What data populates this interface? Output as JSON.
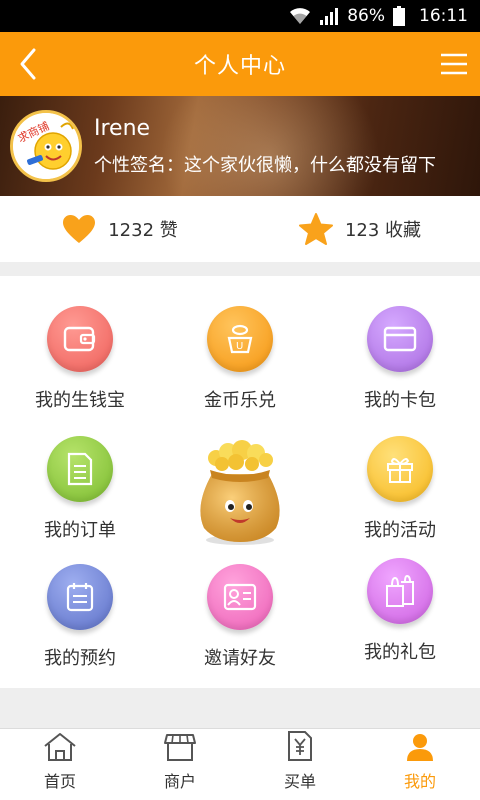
{
  "status_bar": {
    "battery": "86%",
    "time": "16:11"
  },
  "header": {
    "title": "个人中心"
  },
  "profile": {
    "name": "Irene",
    "signature": "个性签名：这个家伙很懒，什么都没有留下",
    "avatar_text": "求商铺"
  },
  "stats": {
    "likes": "1232",
    "likes_label": "赞",
    "favorites": "123",
    "favorites_label": "收藏"
  },
  "grid": [
    {
      "label": "我的生钱宝",
      "icon": "wallet-icon",
      "color": "#f0706b"
    },
    {
      "label": "金币乐兑",
      "icon": "coin-cup-icon",
      "color": "#f7a01e"
    },
    {
      "label": "我的卡包",
      "icon": "card-icon",
      "color": "#b57de6"
    },
    {
      "label": "我的订单",
      "icon": "order-icon",
      "color": "#8cc63e"
    },
    {
      "label": "我的活动",
      "icon": "gift-box-icon",
      "color": "#f9c534"
    },
    {
      "label": "我的预约",
      "icon": "calendar-icon",
      "color": "#6f83d4"
    },
    {
      "label": "邀请好友",
      "icon": "contact-card-icon",
      "color": "#f06bbf"
    },
    {
      "label": "我的礼包",
      "icon": "gift-bag-icon",
      "color": "#d86be8"
    }
  ],
  "bottom_nav": [
    {
      "label": "首页",
      "icon": "home-icon",
      "active": false
    },
    {
      "label": "商户",
      "icon": "shop-icon",
      "active": false
    },
    {
      "label": "买单",
      "icon": "bill-icon",
      "active": false
    },
    {
      "label": "我的",
      "icon": "user-icon",
      "active": true
    }
  ],
  "colors": {
    "accent": "#fb9a0b"
  }
}
